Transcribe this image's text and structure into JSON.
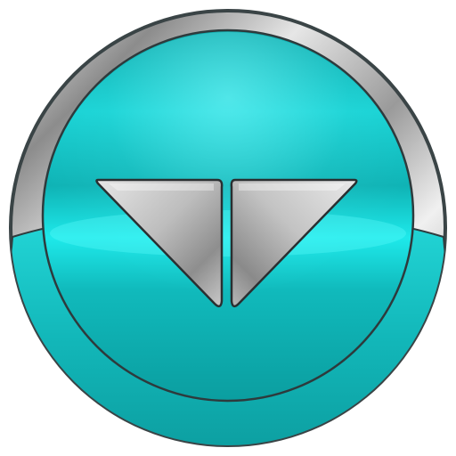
{
  "icon": {
    "name": "teal-round-button-icon",
    "colors": {
      "teal_light": "#19e6e6",
      "teal_mid": "#12c4c6",
      "teal_dark": "#0a9a9c",
      "chrome_light": "#eeeeee",
      "chrome_mid": "#b9b9b9",
      "chrome_dark": "#6f6f6f",
      "outline": "#2e3a3c",
      "background": "#ffffff"
    }
  }
}
